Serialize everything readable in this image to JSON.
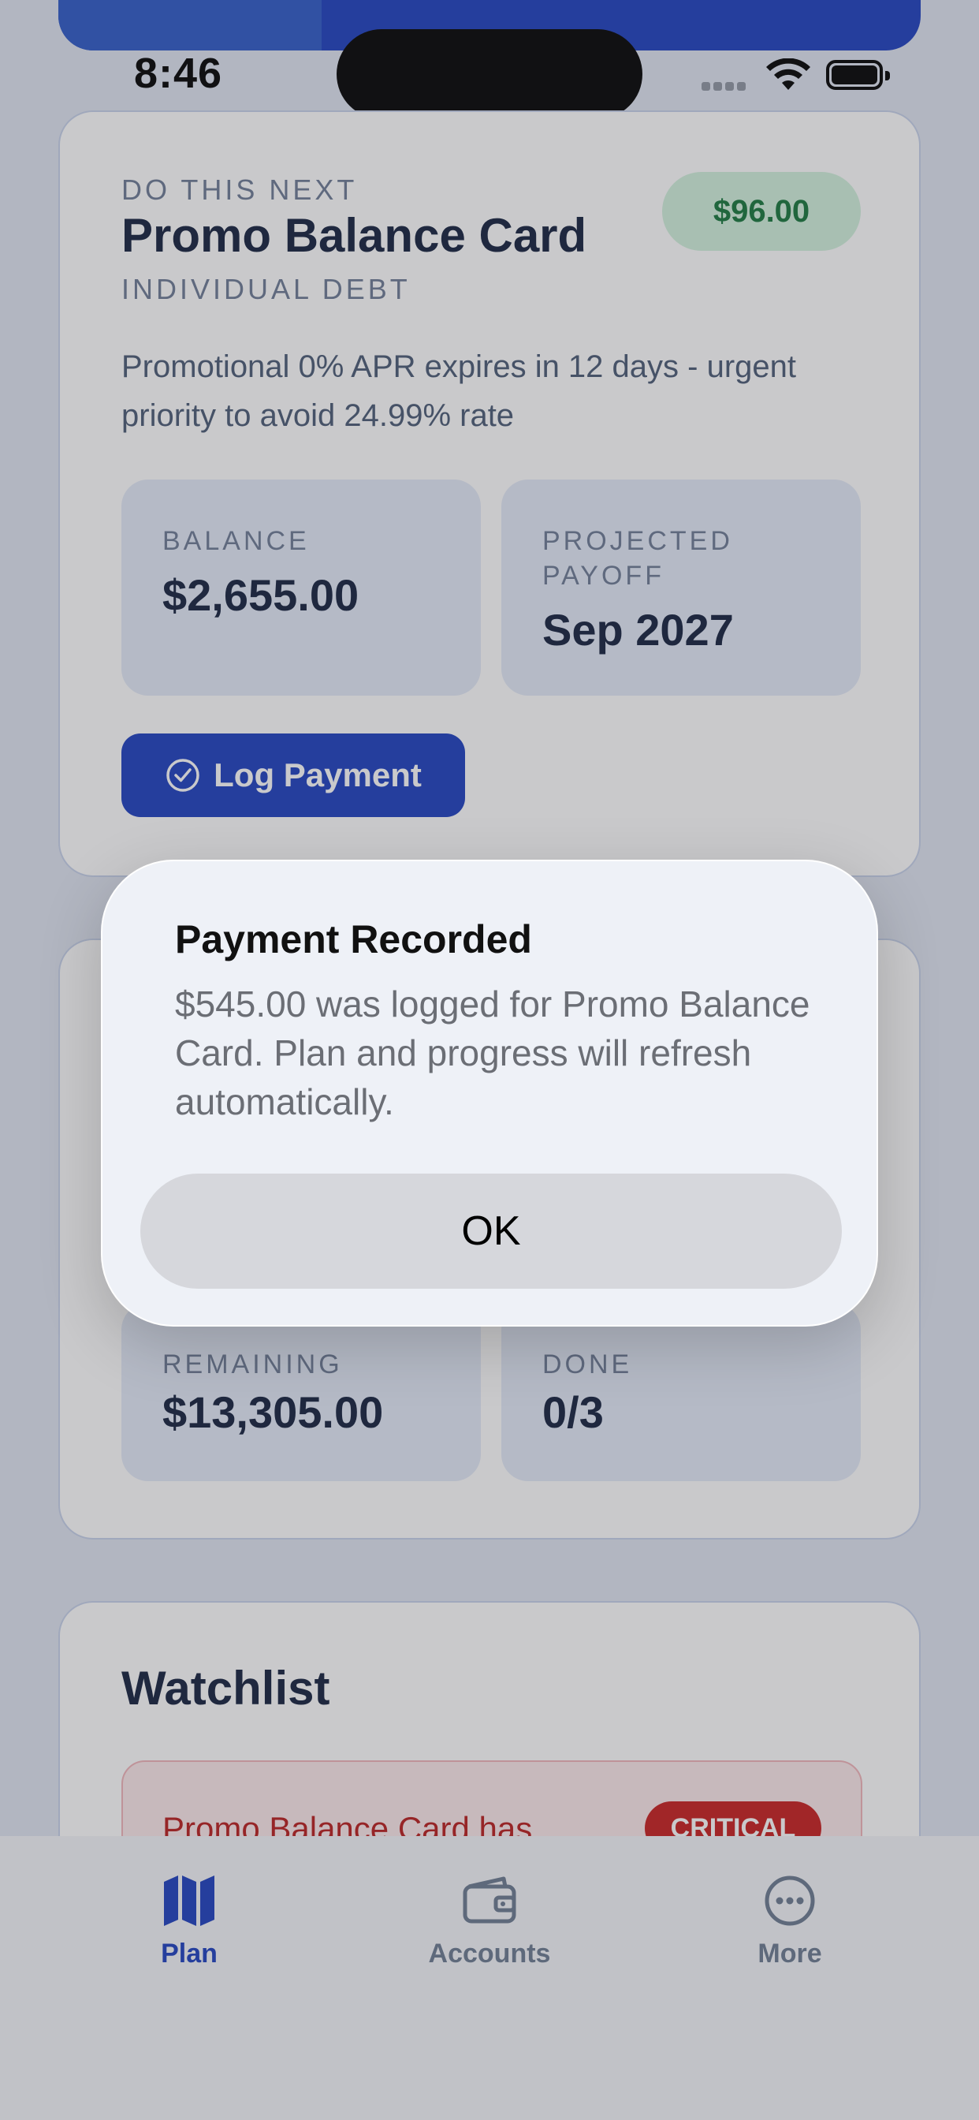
{
  "status_bar": {
    "time": "8:46"
  },
  "next_card": {
    "eyebrow": "DO THIS NEXT",
    "title": "Promo Balance Card",
    "category": "INDIVIDUAL DEBT",
    "amount_badge": "$96.00",
    "description": "Promotional 0% APR expires in 12 days - urgent priority to avoid 24.99% rate",
    "balance": {
      "label": "BALANCE",
      "value": "$2,655.00"
    },
    "payoff": {
      "label": "PROJECTED PAYOFF",
      "value": "Sep 2027"
    },
    "log_button": "Log Payment"
  },
  "progress_card": {
    "remaining": {
      "label": "REMAINING",
      "value": "$13,305.00"
    },
    "done": {
      "label": "DONE",
      "value": "0/3"
    }
  },
  "watchlist": {
    "title": "Watchlist",
    "alert_text": "Promo Balance Card has",
    "alert_badge": "CRITICAL"
  },
  "tabs": [
    {
      "label": "Plan",
      "icon": "map-icon",
      "active": true
    },
    {
      "label": "Accounts",
      "icon": "wallet-icon",
      "active": false
    },
    {
      "label": "More",
      "icon": "ellipsis-circle-icon",
      "active": false
    }
  ],
  "alert": {
    "title": "Payment Recorded",
    "message": "$545.00 was logged for Promo Balance Card. Plan and progress will refresh automatically.",
    "ok_label": "OK"
  },
  "colors": {
    "accent": "#1c3fc0",
    "success_bg": "#d1f1dd",
    "success_text": "#16773b",
    "critical": "#c81e1e"
  }
}
